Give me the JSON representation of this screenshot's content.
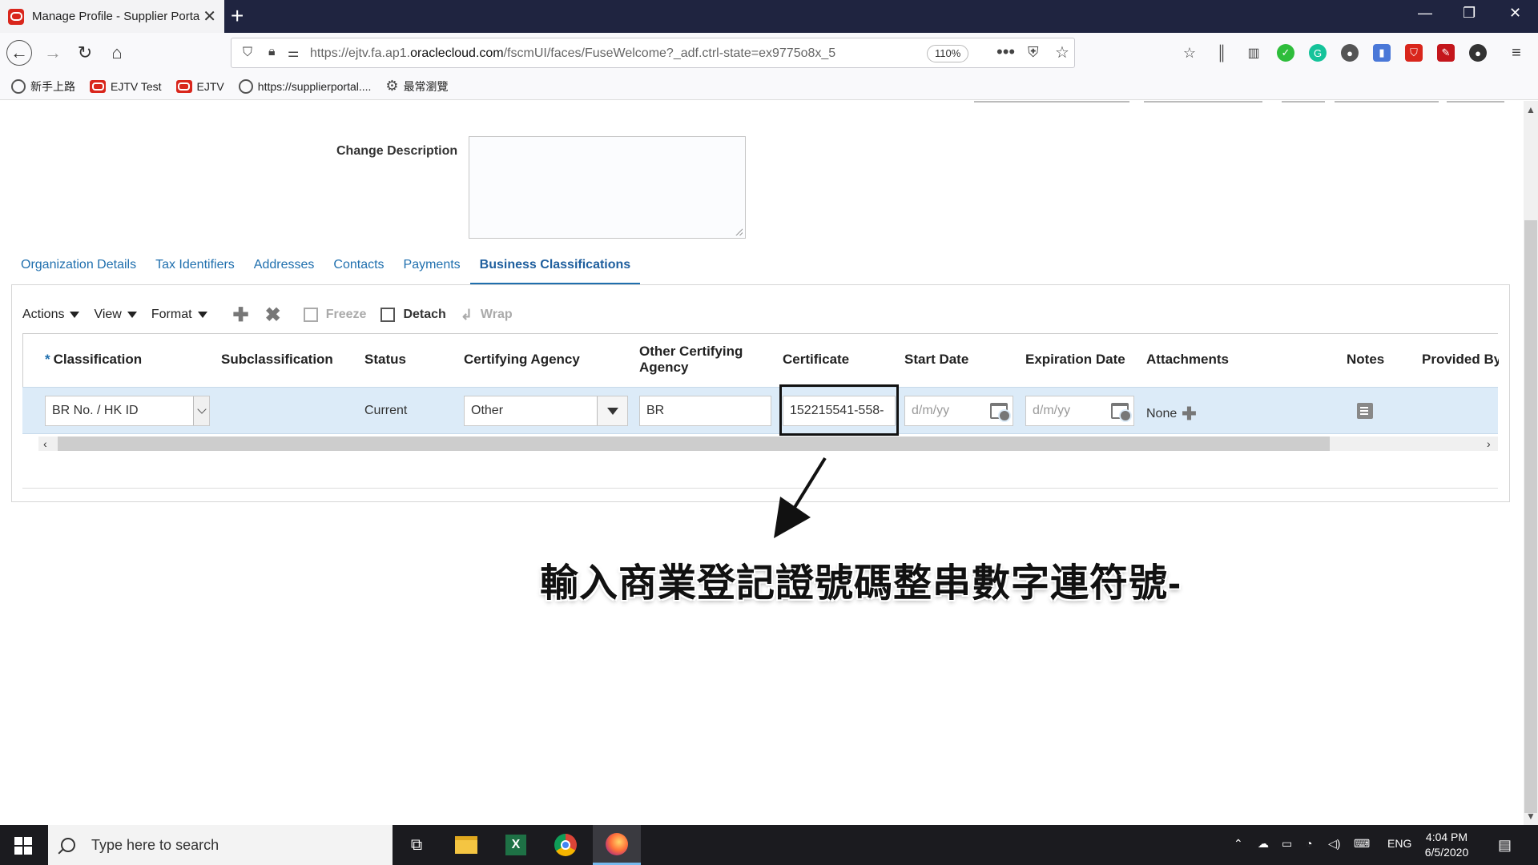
{
  "browser": {
    "tab_title": "Manage Profile - Supplier Portal",
    "url_prefix": "https://ejtv.fa.ap1.",
    "url_domain": "oraclecloud.com",
    "url_suffix": "/fscmUI/faces/FuseWelcome?_adf.ctrl-state=ex9775o8x_5",
    "zoom": "110%",
    "bookmarks": [
      {
        "label": "新手上路",
        "icon": "globe-icon"
      },
      {
        "label": "EJTV Test",
        "icon": "oracle-icon"
      },
      {
        "label": "EJTV",
        "icon": "oracle-icon"
      },
      {
        "label": "https://supplierportal....",
        "icon": "globe-icon"
      },
      {
        "label": "最常瀏覽",
        "icon": "gear-icon"
      }
    ]
  },
  "form": {
    "change_description_label": "Change Description",
    "change_description_value": ""
  },
  "tabs": [
    {
      "label": "Organization Details",
      "active": false
    },
    {
      "label": "Tax Identifiers",
      "active": false
    },
    {
      "label": "Addresses",
      "active": false
    },
    {
      "label": "Contacts",
      "active": false
    },
    {
      "label": "Payments",
      "active": false
    },
    {
      "label": "Business Classifications",
      "active": true
    }
  ],
  "toolbar": {
    "actions": "Actions",
    "view": "View",
    "format": "Format",
    "freeze": "Freeze",
    "detach": "Detach",
    "wrap": "Wrap"
  },
  "table": {
    "required_marker": "*",
    "columns": {
      "classification": "Classification",
      "subclassification": "Subclassification",
      "status": "Status",
      "certifying_agency": "Certifying Agency",
      "other_certifying_agency": "Other Certifying Agency",
      "certificate": "Certificate",
      "start_date": "Start Date",
      "expiration_date": "Expiration Date",
      "attachments": "Attachments",
      "notes": "Notes",
      "provided_by": "Provided By"
    },
    "row": {
      "classification": "BR No. / HK ID",
      "subclassification": "",
      "status": "Current",
      "certifying_agency": "Other",
      "other_certifying_agency": "BR",
      "certificate": "152215541-558-",
      "start_date_placeholder": "d/m/yy",
      "expiration_date_placeholder": "d/m/yy",
      "attachments": "None"
    }
  },
  "annotation": {
    "text": "輸入商業登記證號碼整串數字連符號-"
  },
  "taskbar": {
    "search_placeholder": "Type here to search",
    "language": "ENG",
    "time": "4:04 PM",
    "date": "6/5/2020"
  }
}
